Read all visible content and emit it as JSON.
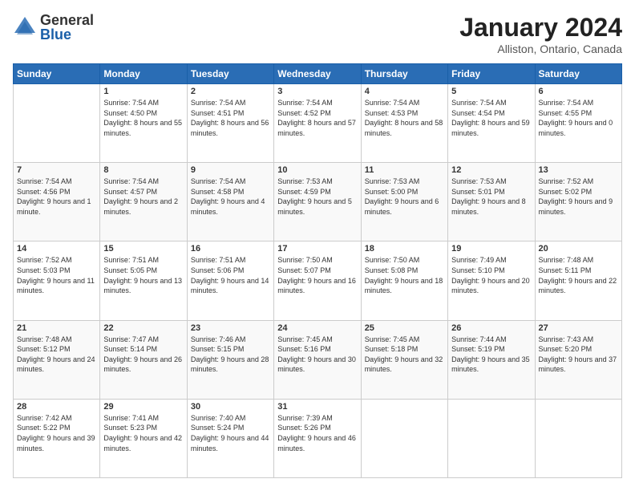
{
  "logo": {
    "general": "General",
    "blue": "Blue"
  },
  "title": "January 2024",
  "location": "Alliston, Ontario, Canada",
  "days_header": [
    "Sunday",
    "Monday",
    "Tuesday",
    "Wednesday",
    "Thursday",
    "Friday",
    "Saturday"
  ],
  "weeks": [
    [
      {
        "day": "",
        "sunrise": "",
        "sunset": "",
        "daylight": ""
      },
      {
        "day": "1",
        "sunrise": "Sunrise: 7:54 AM",
        "sunset": "Sunset: 4:50 PM",
        "daylight": "Daylight: 8 hours and 55 minutes."
      },
      {
        "day": "2",
        "sunrise": "Sunrise: 7:54 AM",
        "sunset": "Sunset: 4:51 PM",
        "daylight": "Daylight: 8 hours and 56 minutes."
      },
      {
        "day": "3",
        "sunrise": "Sunrise: 7:54 AM",
        "sunset": "Sunset: 4:52 PM",
        "daylight": "Daylight: 8 hours and 57 minutes."
      },
      {
        "day": "4",
        "sunrise": "Sunrise: 7:54 AM",
        "sunset": "Sunset: 4:53 PM",
        "daylight": "Daylight: 8 hours and 58 minutes."
      },
      {
        "day": "5",
        "sunrise": "Sunrise: 7:54 AM",
        "sunset": "Sunset: 4:54 PM",
        "daylight": "Daylight: 8 hours and 59 minutes."
      },
      {
        "day": "6",
        "sunrise": "Sunrise: 7:54 AM",
        "sunset": "Sunset: 4:55 PM",
        "daylight": "Daylight: 9 hours and 0 minutes."
      }
    ],
    [
      {
        "day": "7",
        "sunrise": "Sunrise: 7:54 AM",
        "sunset": "Sunset: 4:56 PM",
        "daylight": "Daylight: 9 hours and 1 minute."
      },
      {
        "day": "8",
        "sunrise": "Sunrise: 7:54 AM",
        "sunset": "Sunset: 4:57 PM",
        "daylight": "Daylight: 9 hours and 2 minutes."
      },
      {
        "day": "9",
        "sunrise": "Sunrise: 7:54 AM",
        "sunset": "Sunset: 4:58 PM",
        "daylight": "Daylight: 9 hours and 4 minutes."
      },
      {
        "day": "10",
        "sunrise": "Sunrise: 7:53 AM",
        "sunset": "Sunset: 4:59 PM",
        "daylight": "Daylight: 9 hours and 5 minutes."
      },
      {
        "day": "11",
        "sunrise": "Sunrise: 7:53 AM",
        "sunset": "Sunset: 5:00 PM",
        "daylight": "Daylight: 9 hours and 6 minutes."
      },
      {
        "day": "12",
        "sunrise": "Sunrise: 7:53 AM",
        "sunset": "Sunset: 5:01 PM",
        "daylight": "Daylight: 9 hours and 8 minutes."
      },
      {
        "day": "13",
        "sunrise": "Sunrise: 7:52 AM",
        "sunset": "Sunset: 5:02 PM",
        "daylight": "Daylight: 9 hours and 9 minutes."
      }
    ],
    [
      {
        "day": "14",
        "sunrise": "Sunrise: 7:52 AM",
        "sunset": "Sunset: 5:03 PM",
        "daylight": "Daylight: 9 hours and 11 minutes."
      },
      {
        "day": "15",
        "sunrise": "Sunrise: 7:51 AM",
        "sunset": "Sunset: 5:05 PM",
        "daylight": "Daylight: 9 hours and 13 minutes."
      },
      {
        "day": "16",
        "sunrise": "Sunrise: 7:51 AM",
        "sunset": "Sunset: 5:06 PM",
        "daylight": "Daylight: 9 hours and 14 minutes."
      },
      {
        "day": "17",
        "sunrise": "Sunrise: 7:50 AM",
        "sunset": "Sunset: 5:07 PM",
        "daylight": "Daylight: 9 hours and 16 minutes."
      },
      {
        "day": "18",
        "sunrise": "Sunrise: 7:50 AM",
        "sunset": "Sunset: 5:08 PM",
        "daylight": "Daylight: 9 hours and 18 minutes."
      },
      {
        "day": "19",
        "sunrise": "Sunrise: 7:49 AM",
        "sunset": "Sunset: 5:10 PM",
        "daylight": "Daylight: 9 hours and 20 minutes."
      },
      {
        "day": "20",
        "sunrise": "Sunrise: 7:48 AM",
        "sunset": "Sunset: 5:11 PM",
        "daylight": "Daylight: 9 hours and 22 minutes."
      }
    ],
    [
      {
        "day": "21",
        "sunrise": "Sunrise: 7:48 AM",
        "sunset": "Sunset: 5:12 PM",
        "daylight": "Daylight: 9 hours and 24 minutes."
      },
      {
        "day": "22",
        "sunrise": "Sunrise: 7:47 AM",
        "sunset": "Sunset: 5:14 PM",
        "daylight": "Daylight: 9 hours and 26 minutes."
      },
      {
        "day": "23",
        "sunrise": "Sunrise: 7:46 AM",
        "sunset": "Sunset: 5:15 PM",
        "daylight": "Daylight: 9 hours and 28 minutes."
      },
      {
        "day": "24",
        "sunrise": "Sunrise: 7:45 AM",
        "sunset": "Sunset: 5:16 PM",
        "daylight": "Daylight: 9 hours and 30 minutes."
      },
      {
        "day": "25",
        "sunrise": "Sunrise: 7:45 AM",
        "sunset": "Sunset: 5:18 PM",
        "daylight": "Daylight: 9 hours and 32 minutes."
      },
      {
        "day": "26",
        "sunrise": "Sunrise: 7:44 AM",
        "sunset": "Sunset: 5:19 PM",
        "daylight": "Daylight: 9 hours and 35 minutes."
      },
      {
        "day": "27",
        "sunrise": "Sunrise: 7:43 AM",
        "sunset": "Sunset: 5:20 PM",
        "daylight": "Daylight: 9 hours and 37 minutes."
      }
    ],
    [
      {
        "day": "28",
        "sunrise": "Sunrise: 7:42 AM",
        "sunset": "Sunset: 5:22 PM",
        "daylight": "Daylight: 9 hours and 39 minutes."
      },
      {
        "day": "29",
        "sunrise": "Sunrise: 7:41 AM",
        "sunset": "Sunset: 5:23 PM",
        "daylight": "Daylight: 9 hours and 42 minutes."
      },
      {
        "day": "30",
        "sunrise": "Sunrise: 7:40 AM",
        "sunset": "Sunset: 5:24 PM",
        "daylight": "Daylight: 9 hours and 44 minutes."
      },
      {
        "day": "31",
        "sunrise": "Sunrise: 7:39 AM",
        "sunset": "Sunset: 5:26 PM",
        "daylight": "Daylight: 9 hours and 46 minutes."
      },
      {
        "day": "",
        "sunrise": "",
        "sunset": "",
        "daylight": ""
      },
      {
        "day": "",
        "sunrise": "",
        "sunset": "",
        "daylight": ""
      },
      {
        "day": "",
        "sunrise": "",
        "sunset": "",
        "daylight": ""
      }
    ]
  ]
}
